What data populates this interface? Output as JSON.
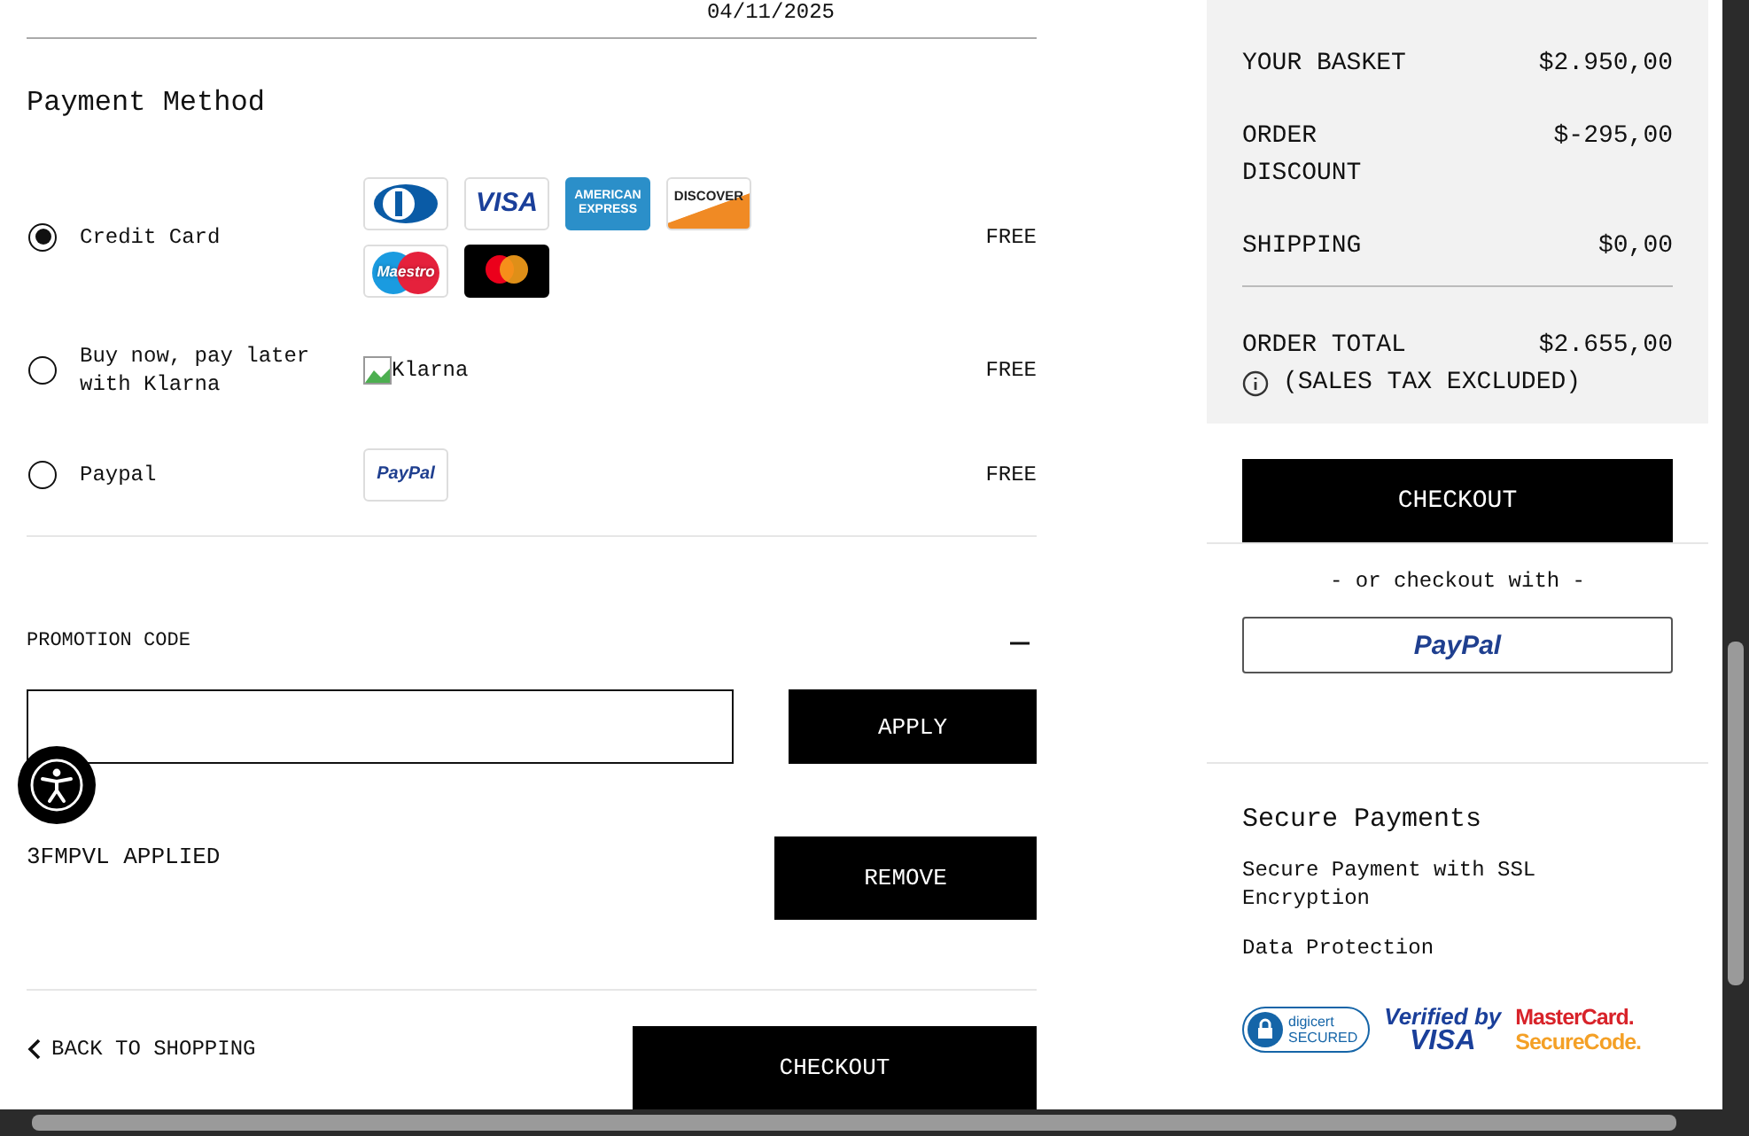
{
  "header": {
    "date": "04/11/2025"
  },
  "payment": {
    "title": "Payment Method",
    "methods": [
      {
        "label": "Credit Card",
        "selected": true,
        "price": "FREE",
        "logos": [
          {
            "kind": "diners"
          },
          {
            "kind": "visa",
            "text": "VISA"
          },
          {
            "kind": "amex",
            "text": "AMERICAN EXPRESS"
          },
          {
            "kind": "discover",
            "text": "DISCOVER"
          },
          {
            "kind": "maestro",
            "text": "Maestro"
          },
          {
            "kind": "mastercard"
          }
        ]
      },
      {
        "label": "Buy now, pay later with Klarna",
        "selected": false,
        "price": "FREE",
        "logos": [
          {
            "kind": "broken",
            "text": "Klarna"
          }
        ]
      },
      {
        "label": "Paypal",
        "selected": false,
        "price": "FREE",
        "logos": [
          {
            "kind": "paypal",
            "text": "PayPal"
          }
        ]
      }
    ]
  },
  "promotion": {
    "label": "PROMOTION CODE",
    "expanded": true,
    "apply": "APPLY",
    "applied": "3FMPVL APPLIED",
    "remove": "REMOVE"
  },
  "footer": {
    "back": "BACK TO SHOPPING",
    "checkout": "CHECKOUT"
  },
  "summary": {
    "rows": [
      {
        "label": "YOUR BASKET",
        "value": "$2.950,00"
      },
      {
        "label": "ORDER DISCOUNT",
        "value": "$-295,00"
      },
      {
        "label": "SHIPPING",
        "value": "$0,00"
      }
    ],
    "total": {
      "label": "ORDER TOTAL",
      "value": "$2.655,00",
      "note": "(SALES TAX EXCLUDED)"
    },
    "checkout": "CHECKOUT",
    "alt": "- or checkout with -",
    "paypal": "PayPal"
  },
  "secure": {
    "title": "Secure Payments",
    "items": [
      "Secure Payment with SSL Encryption",
      "Data Protection"
    ],
    "badges": [
      {
        "kind": "digicert",
        "lines": [
          "digicert",
          "SECURED"
        ]
      },
      {
        "kind": "visa",
        "lines": [
          "Verified by",
          "VISA"
        ]
      },
      {
        "kind": "mastercard",
        "lines": [
          "MasterCard.",
          "SecureCode."
        ]
      }
    ]
  }
}
